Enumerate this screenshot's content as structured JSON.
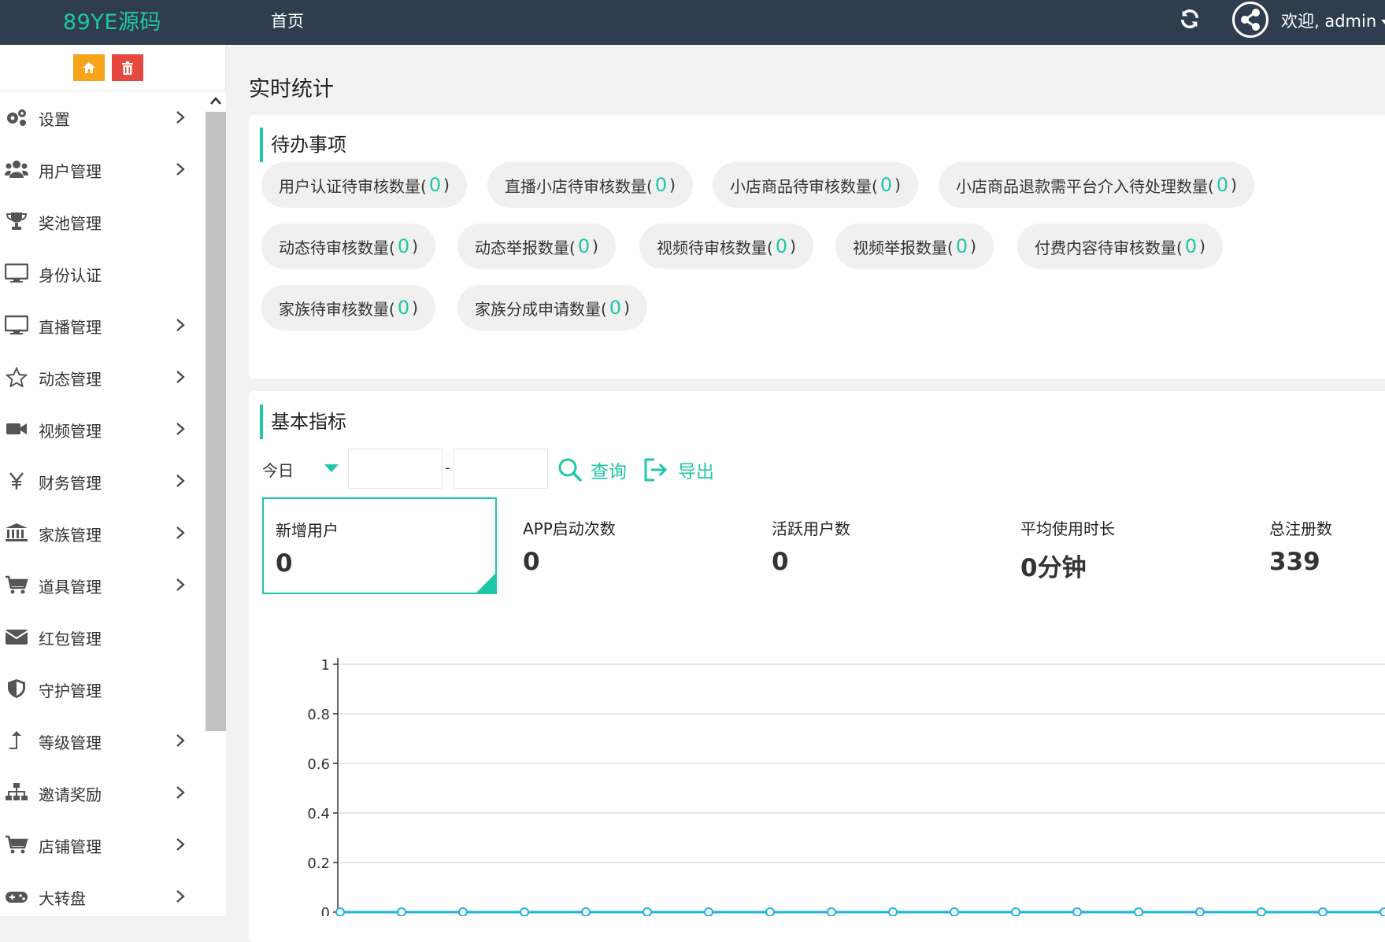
{
  "header": {
    "logo": "89YE源码",
    "nav_home": "首页",
    "welcome": "欢迎, admin"
  },
  "sidebar": {
    "items": [
      {
        "label": "设置",
        "icon": "gears-icon",
        "arrow": true
      },
      {
        "label": "用户管理",
        "icon": "users-icon",
        "arrow": true
      },
      {
        "label": "奖池管理",
        "icon": "trophy-icon",
        "arrow": false
      },
      {
        "label": "身份认证",
        "icon": "monitor-icon",
        "arrow": false
      },
      {
        "label": "直播管理",
        "icon": "monitor-icon",
        "arrow": true
      },
      {
        "label": "动态管理",
        "icon": "star-icon",
        "arrow": true
      },
      {
        "label": "视频管理",
        "icon": "video-camera-icon",
        "arrow": true
      },
      {
        "label": "财务管理",
        "icon": "yen-icon",
        "arrow": true
      },
      {
        "label": "家族管理",
        "icon": "bank-icon",
        "arrow": true
      },
      {
        "label": "道具管理",
        "icon": "cart-icon",
        "arrow": true
      },
      {
        "label": "红包管理",
        "icon": "envelope-icon",
        "arrow": false
      },
      {
        "label": "守护管理",
        "icon": "shield-icon",
        "arrow": false
      },
      {
        "label": "等级管理",
        "icon": "level-up-icon",
        "arrow": true
      },
      {
        "label": "邀请奖励",
        "icon": "sitemap-icon",
        "arrow": true
      },
      {
        "label": "店铺管理",
        "icon": "cart-icon",
        "arrow": true
      },
      {
        "label": "大转盘",
        "icon": "gamepad-icon",
        "arrow": true
      }
    ]
  },
  "main": {
    "page_title": "实时统计",
    "todo": {
      "title": "待办事项",
      "rows": [
        [
          {
            "label": "用户认证待审核数量(",
            "count": "0"
          },
          {
            "label": "直播小店待审核数量(",
            "count": "0"
          },
          {
            "label": "小店商品待审核数量(",
            "count": "0"
          },
          {
            "label": "小店商品退款需平台介入待处理数量(",
            "count": "0"
          }
        ],
        [
          {
            "label": "动态待审核数量(",
            "count": "0"
          },
          {
            "label": "动态举报数量(",
            "count": "0"
          },
          {
            "label": "视频待审核数量(",
            "count": "0"
          },
          {
            "label": "视频举报数量(",
            "count": "0"
          },
          {
            "label": "付费内容待审核数量(",
            "count": "0"
          }
        ],
        [
          {
            "label": "家族待审核数量(",
            "count": "0"
          },
          {
            "label": "家族分成申请数量(",
            "count": "0"
          }
        ]
      ]
    },
    "basic": {
      "title": "基本指标",
      "range": "今日",
      "start_date": "",
      "end_date": "",
      "query": "查询",
      "export": "导出",
      "metrics": [
        {
          "label": "新增用户",
          "value": "0",
          "active": true
        },
        {
          "label": "APP启动次数",
          "value": "0",
          "active": false
        },
        {
          "label": "活跃用户数",
          "value": "0",
          "active": false
        },
        {
          "label": "平均使用时长",
          "value": "0分钟",
          "active": false
        },
        {
          "label": "总注册数",
          "value": "339",
          "active": false
        }
      ]
    }
  },
  "colors": {
    "accent": "#1fc7a6",
    "topbar": "#2f3d4f",
    "home_btn": "#f7a31c",
    "delete_btn": "#e5483f"
  },
  "chart_data": {
    "type": "line",
    "ylim": [
      0,
      1
    ],
    "yticks": [
      "0",
      "0.2",
      "0.4",
      "0.6",
      "0.8",
      "1"
    ],
    "series": [
      {
        "values": [
          0,
          0,
          0,
          0,
          0,
          0,
          0,
          0,
          0,
          0,
          0,
          0,
          0,
          0,
          0,
          0,
          0,
          0,
          0
        ]
      }
    ]
  }
}
